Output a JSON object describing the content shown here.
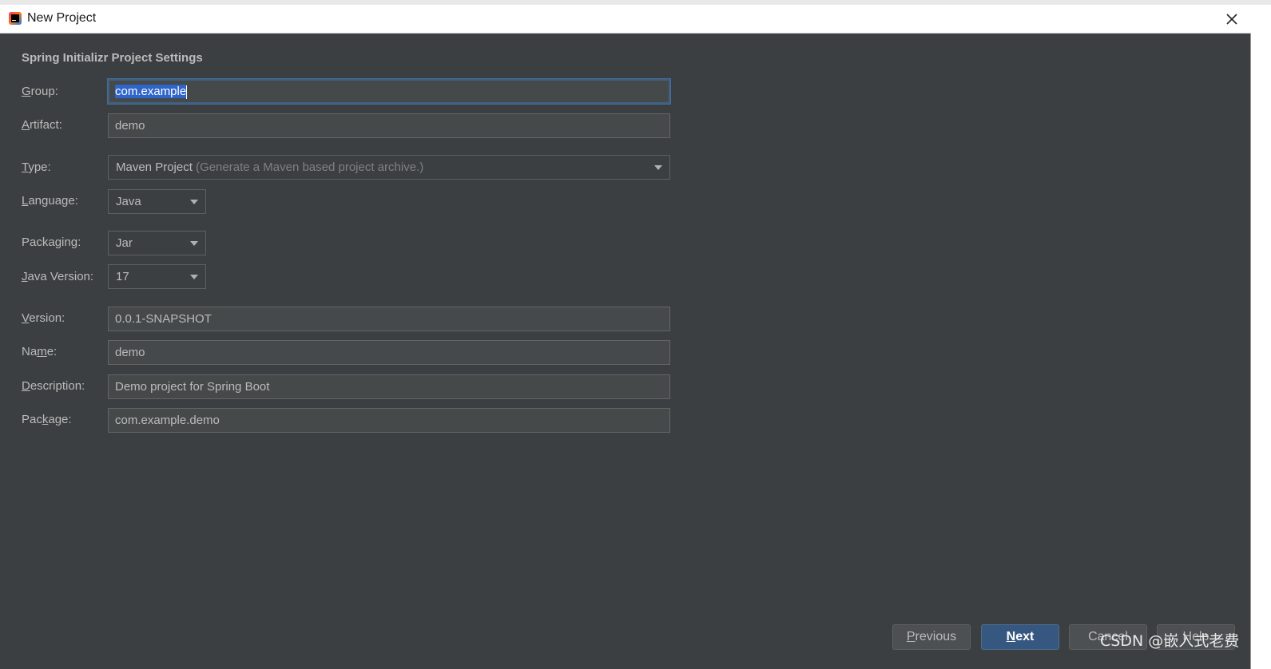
{
  "window": {
    "title": "New Project"
  },
  "section_title": "Spring Initializr Project Settings",
  "fields": {
    "group": {
      "label_mn": "G",
      "label_rest": "roup:",
      "value": "com.example"
    },
    "artifact": {
      "label_mn": "A",
      "label_rest": "rtifact:",
      "value": "demo"
    },
    "type": {
      "label_mn": "T",
      "label_rest": "ype:",
      "value": "Maven Project",
      "hint": "(Generate a Maven based project archive.)"
    },
    "language": {
      "label_mn": "L",
      "label_rest": "anguage:",
      "value": "Java"
    },
    "packaging": {
      "label_pre": "Packa",
      "label_mn": "g",
      "label_rest": "ing:",
      "value": "Jar"
    },
    "java_version": {
      "label_mn": "J",
      "label_rest": "ava Version:",
      "value": "17"
    },
    "version": {
      "label_mn": "V",
      "label_rest": "ersion:",
      "value": "0.0.1-SNAPSHOT"
    },
    "name": {
      "label_pre": "Na",
      "label_mn": "m",
      "label_rest": "e:",
      "value": "demo"
    },
    "description": {
      "label_mn": "D",
      "label_rest": "escription:",
      "value": "Demo project for Spring Boot"
    },
    "package": {
      "label_pre": "Pac",
      "label_mn": "k",
      "label_rest": "age:",
      "value": "com.example.demo"
    }
  },
  "buttons": {
    "previous_mn": "P",
    "previous_rest": "revious",
    "next_mn": "N",
    "next_rest": "ext",
    "cancel": "Cancel",
    "help": "Help"
  },
  "watermark": "CSDN @嵌入式老费",
  "colors": {
    "dialog_bg": "#3c3f41",
    "field_bg": "#45494a",
    "focus_border": "#3d6185",
    "selection": "#2f65ca",
    "primary_button": "#365880",
    "text": "#bbbbbb"
  }
}
